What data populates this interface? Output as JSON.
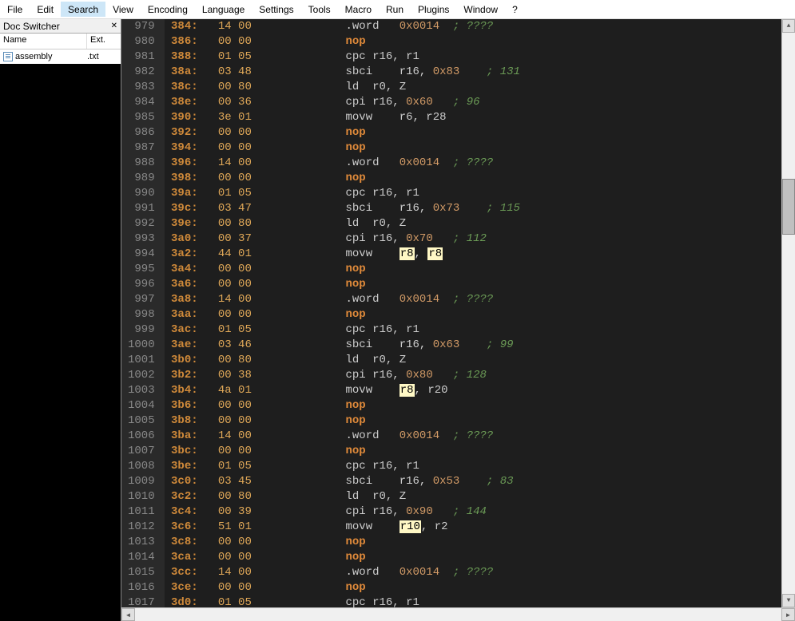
{
  "menu": {
    "items": [
      "File",
      "Edit",
      "Search",
      "View",
      "Encoding",
      "Language",
      "Settings",
      "Tools",
      "Macro",
      "Run",
      "Plugins",
      "Window",
      "?"
    ],
    "selected_index": 2
  },
  "doc_switcher": {
    "title": "Doc Switcher",
    "headers": {
      "name": "Name",
      "ext": "Ext."
    },
    "rows": [
      {
        "name": "assembly",
        "ext": ".txt"
      }
    ]
  },
  "editor": {
    "first_line_number": 979,
    "lines": [
      {
        "addr": "384:",
        "hex": "14 00",
        "parts": [
          {
            "t": "instr",
            "v": ".word   "
          },
          {
            "t": "num",
            "v": "0x0014"
          },
          {
            "t": "cmt",
            "v": "  ; ????"
          }
        ]
      },
      {
        "addr": "386:",
        "hex": "00 00",
        "parts": [
          {
            "t": "kw",
            "v": "nop"
          }
        ]
      },
      {
        "addr": "388:",
        "hex": "01 05",
        "parts": [
          {
            "t": "instr",
            "v": "cpc r16, r1"
          }
        ]
      },
      {
        "addr": "38a:",
        "hex": "03 48",
        "parts": [
          {
            "t": "instr",
            "v": "sbci    r16, "
          },
          {
            "t": "num",
            "v": "0x83"
          },
          {
            "t": "cmt",
            "v": "    ; 131"
          }
        ]
      },
      {
        "addr": "38c:",
        "hex": "00 80",
        "parts": [
          {
            "t": "instr",
            "v": "ld  r0, Z"
          }
        ]
      },
      {
        "addr": "38e:",
        "hex": "00 36",
        "parts": [
          {
            "t": "instr",
            "v": "cpi r16, "
          },
          {
            "t": "num",
            "v": "0x60"
          },
          {
            "t": "cmt",
            "v": "   ; 96"
          }
        ]
      },
      {
        "addr": "390:",
        "hex": "3e 01",
        "parts": [
          {
            "t": "instr",
            "v": "movw    r6, r28"
          }
        ]
      },
      {
        "addr": "392:",
        "hex": "00 00",
        "parts": [
          {
            "t": "kw",
            "v": "nop"
          }
        ]
      },
      {
        "addr": "394:",
        "hex": "00 00",
        "parts": [
          {
            "t": "kw",
            "v": "nop"
          }
        ]
      },
      {
        "addr": "396:",
        "hex": "14 00",
        "parts": [
          {
            "t": "instr",
            "v": ".word   "
          },
          {
            "t": "num",
            "v": "0x0014"
          },
          {
            "t": "cmt",
            "v": "  ; ????"
          }
        ]
      },
      {
        "addr": "398:",
        "hex": "00 00",
        "parts": [
          {
            "t": "kw",
            "v": "nop"
          }
        ]
      },
      {
        "addr": "39a:",
        "hex": "01 05",
        "parts": [
          {
            "t": "instr",
            "v": "cpc r16, r1"
          }
        ]
      },
      {
        "addr": "39c:",
        "hex": "03 47",
        "parts": [
          {
            "t": "instr",
            "v": "sbci    r16, "
          },
          {
            "t": "num",
            "v": "0x73"
          },
          {
            "t": "cmt",
            "v": "    ; 115"
          }
        ]
      },
      {
        "addr": "39e:",
        "hex": "00 80",
        "parts": [
          {
            "t": "instr",
            "v": "ld  r0, Z"
          }
        ]
      },
      {
        "addr": "3a0:",
        "hex": "00 37",
        "parts": [
          {
            "t": "instr",
            "v": "cpi r16, "
          },
          {
            "t": "num",
            "v": "0x70"
          },
          {
            "t": "cmt",
            "v": "   ; 112"
          }
        ]
      },
      {
        "addr": "3a2:",
        "hex": "44 01",
        "parts": [
          {
            "t": "instr",
            "v": "movw    "
          },
          {
            "t": "hl",
            "v": "r8"
          },
          {
            "t": "instr",
            "v": ", "
          },
          {
            "t": "hl",
            "v": "r8"
          }
        ]
      },
      {
        "addr": "3a4:",
        "hex": "00 00",
        "parts": [
          {
            "t": "kw",
            "v": "nop"
          }
        ]
      },
      {
        "addr": "3a6:",
        "hex": "00 00",
        "parts": [
          {
            "t": "kw",
            "v": "nop"
          }
        ]
      },
      {
        "addr": "3a8:",
        "hex": "14 00",
        "parts": [
          {
            "t": "instr",
            "v": ".word   "
          },
          {
            "t": "num",
            "v": "0x0014"
          },
          {
            "t": "cmt",
            "v": "  ; ????"
          }
        ]
      },
      {
        "addr": "3aa:",
        "hex": "00 00",
        "parts": [
          {
            "t": "kw",
            "v": "nop"
          }
        ]
      },
      {
        "addr": "3ac:",
        "hex": "01 05",
        "parts": [
          {
            "t": "instr",
            "v": "cpc r16, r1"
          }
        ]
      },
      {
        "addr": "3ae:",
        "hex": "03 46",
        "parts": [
          {
            "t": "instr",
            "v": "sbci    r16, "
          },
          {
            "t": "num",
            "v": "0x63"
          },
          {
            "t": "cmt",
            "v": "    ; 99"
          }
        ]
      },
      {
        "addr": "3b0:",
        "hex": "00 80",
        "parts": [
          {
            "t": "instr",
            "v": "ld  r0, Z"
          }
        ]
      },
      {
        "addr": "3b2:",
        "hex": "00 38",
        "parts": [
          {
            "t": "instr",
            "v": "cpi r16, "
          },
          {
            "t": "num",
            "v": "0x80"
          },
          {
            "t": "cmt",
            "v": "   ; 128"
          }
        ]
      },
      {
        "addr": "3b4:",
        "hex": "4a 01",
        "parts": [
          {
            "t": "instr",
            "v": "movw    "
          },
          {
            "t": "hl",
            "v": "r8"
          },
          {
            "t": "instr",
            "v": ", r20"
          }
        ]
      },
      {
        "addr": "3b6:",
        "hex": "00 00",
        "parts": [
          {
            "t": "kw",
            "v": "nop"
          }
        ]
      },
      {
        "addr": "3b8:",
        "hex": "00 00",
        "parts": [
          {
            "t": "kw",
            "v": "nop"
          }
        ]
      },
      {
        "addr": "3ba:",
        "hex": "14 00",
        "parts": [
          {
            "t": "instr",
            "v": ".word   "
          },
          {
            "t": "num",
            "v": "0x0014"
          },
          {
            "t": "cmt",
            "v": "  ; ????"
          }
        ]
      },
      {
        "addr": "3bc:",
        "hex": "00 00",
        "parts": [
          {
            "t": "kw",
            "v": "nop"
          }
        ]
      },
      {
        "addr": "3be:",
        "hex": "01 05",
        "parts": [
          {
            "t": "instr",
            "v": "cpc r16, r1"
          }
        ]
      },
      {
        "addr": "3c0:",
        "hex": "03 45",
        "parts": [
          {
            "t": "instr",
            "v": "sbci    r16, "
          },
          {
            "t": "num",
            "v": "0x53"
          },
          {
            "t": "cmt",
            "v": "    ; 83"
          }
        ]
      },
      {
        "addr": "3c2:",
        "hex": "00 80",
        "parts": [
          {
            "t": "instr",
            "v": "ld  r0, Z"
          }
        ]
      },
      {
        "addr": "3c4:",
        "hex": "00 39",
        "parts": [
          {
            "t": "instr",
            "v": "cpi r16, "
          },
          {
            "t": "num",
            "v": "0x90"
          },
          {
            "t": "cmt",
            "v": "   ; 144"
          }
        ]
      },
      {
        "addr": "3c6:",
        "hex": "51 01",
        "parts": [
          {
            "t": "instr",
            "v": "movw    "
          },
          {
            "t": "hl",
            "v": "r10"
          },
          {
            "t": "instr",
            "v": ", r2"
          }
        ]
      },
      {
        "addr": "3c8:",
        "hex": "00 00",
        "parts": [
          {
            "t": "kw",
            "v": "nop"
          }
        ]
      },
      {
        "addr": "3ca:",
        "hex": "00 00",
        "parts": [
          {
            "t": "kw",
            "v": "nop"
          }
        ]
      },
      {
        "addr": "3cc:",
        "hex": "14 00",
        "parts": [
          {
            "t": "instr",
            "v": ".word   "
          },
          {
            "t": "num",
            "v": "0x0014"
          },
          {
            "t": "cmt",
            "v": "  ; ????"
          }
        ]
      },
      {
        "addr": "3ce:",
        "hex": "00 00",
        "parts": [
          {
            "t": "kw",
            "v": "nop"
          }
        ]
      },
      {
        "addr": "3d0:",
        "hex": "01 05",
        "parts": [
          {
            "t": "instr",
            "v": "cpc r16, r1"
          }
        ]
      }
    ]
  }
}
